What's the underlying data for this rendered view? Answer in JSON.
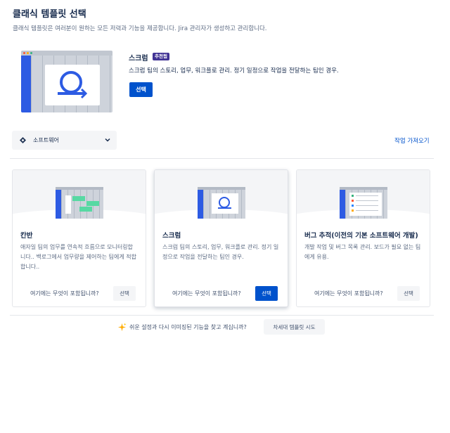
{
  "header": {
    "title": "클래식 템플릿 선택",
    "subtitle": "클래식 템플릿은 여러분이 원하는 모든 저력과 기능을 제공합니다. Jira 관리자가 생성하고 관리합니다."
  },
  "featured": {
    "name": "스크럼",
    "badge": "추천됨",
    "description": "스크럼 팀의 스토리, 업무, 워크플로 관리. 정기 일정으로 작업을 전달하는 팀인 경우.",
    "select_label": "선택"
  },
  "filter": {
    "category": "소프트웨어",
    "import_link": "작업 가져오기"
  },
  "templates": [
    {
      "name": "칸반",
      "description": "애자일 팀의 업무를 연속적 흐름으로 모니터링합니다.. 백로그에서 업무량을 제어하는 팀에게 적합합니다..",
      "includes_label": "여기에는 무엇이 포함됩니까?",
      "select_label": "선택"
    },
    {
      "name": "스크럼",
      "description": "스크럼 팀의 스토리, 업무, 워크플로 관리. 정기 일정으로 작업을 전달하는 팀인 경우.",
      "includes_label": "여기에는 무엇이 포함됩니까?",
      "select_label": "선택"
    },
    {
      "name": "버그 추적(이전의 기본 소프트웨어 개발)",
      "description": "개발 작업 및 버그 목록 관리. 보드가 필요 없는 팀에게 유용.",
      "includes_label": "여기에는 무엇이 포함됩니까?",
      "select_label": "선택"
    }
  ],
  "footer": {
    "prompt": "쉬운 설정과 다시 이미징된 기능을 찾고 계십니까?",
    "button": "차세대 템플릿 시도"
  },
  "colors": {
    "primary": "#0052cc",
    "badge": "#403294",
    "board_blue": "#2d5be3"
  },
  "icons": [
    "jira-software-icon",
    "chevron-down-icon",
    "sparkle-icon",
    "scrum-cycle-icon"
  ]
}
